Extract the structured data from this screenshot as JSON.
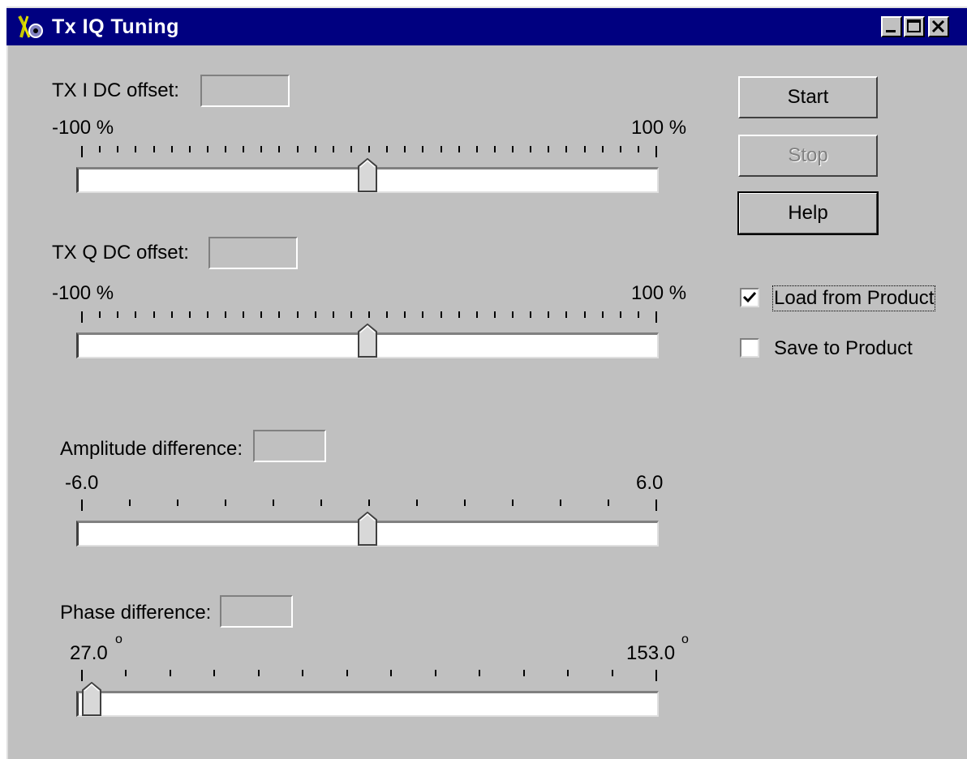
{
  "window": {
    "title": "Tx IQ Tuning"
  },
  "sliders": {
    "i_dc": {
      "label": "TX I DC offset:",
      "value": "",
      "min_label": "-100 %",
      "max_label": "100 %",
      "position": 0.5
    },
    "q_dc": {
      "label": "TX Q DC offset:",
      "value": "",
      "min_label": "-100 %",
      "max_label": "100 %",
      "position": 0.5
    },
    "amp": {
      "label": "Amplitude difference:",
      "value": "",
      "min_label": "-6.0",
      "max_label": "6.0",
      "position": 0.5
    },
    "phase": {
      "label": "Phase difference:",
      "value": "",
      "min_label": "27.0",
      "max_label": "153.0",
      "degree": "o",
      "position": 0.0
    }
  },
  "buttons": {
    "start": "Start",
    "stop": "Stop",
    "help": "Help"
  },
  "checkboxes": {
    "load": {
      "label": "Load from Product",
      "checked": true
    },
    "save": {
      "label": "Save to Product",
      "checked": false
    }
  }
}
